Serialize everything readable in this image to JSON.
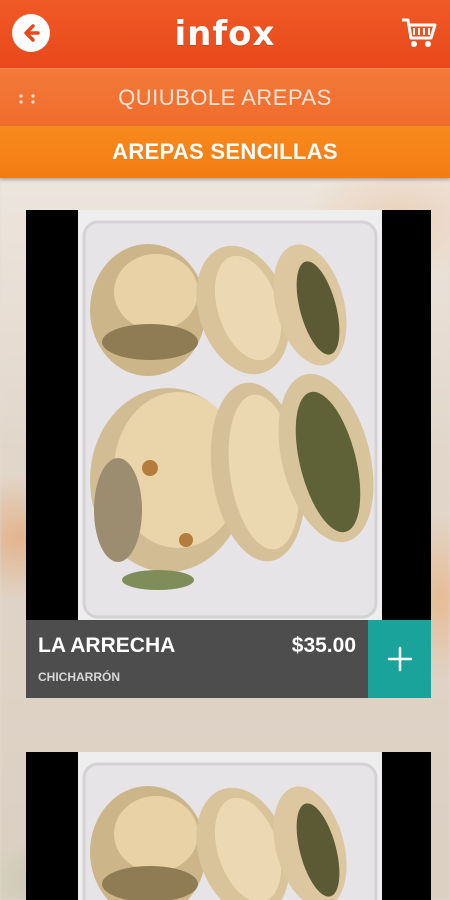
{
  "header": {
    "logo_text": "infox",
    "back_icon": "arrow-left-icon",
    "cart_icon": "shopping-cart-icon"
  },
  "restaurant": {
    "name": "QUIUBOLE AREPAS",
    "handle_icon": "drag-handle-icon"
  },
  "category": {
    "title": "AREPAS SENCILLAS"
  },
  "products": [
    {
      "name": "LA ARRECHA",
      "price": "$35.00",
      "description": "CHICHARRÓN",
      "add_icon": "plus-icon"
    }
  ],
  "colors": {
    "topbar": "#e9481b",
    "restaurant_bar": "#f06c2c",
    "category_bar": "#f47c12",
    "card_info": "#4d4d4d",
    "add_button": "#1aa39a"
  }
}
